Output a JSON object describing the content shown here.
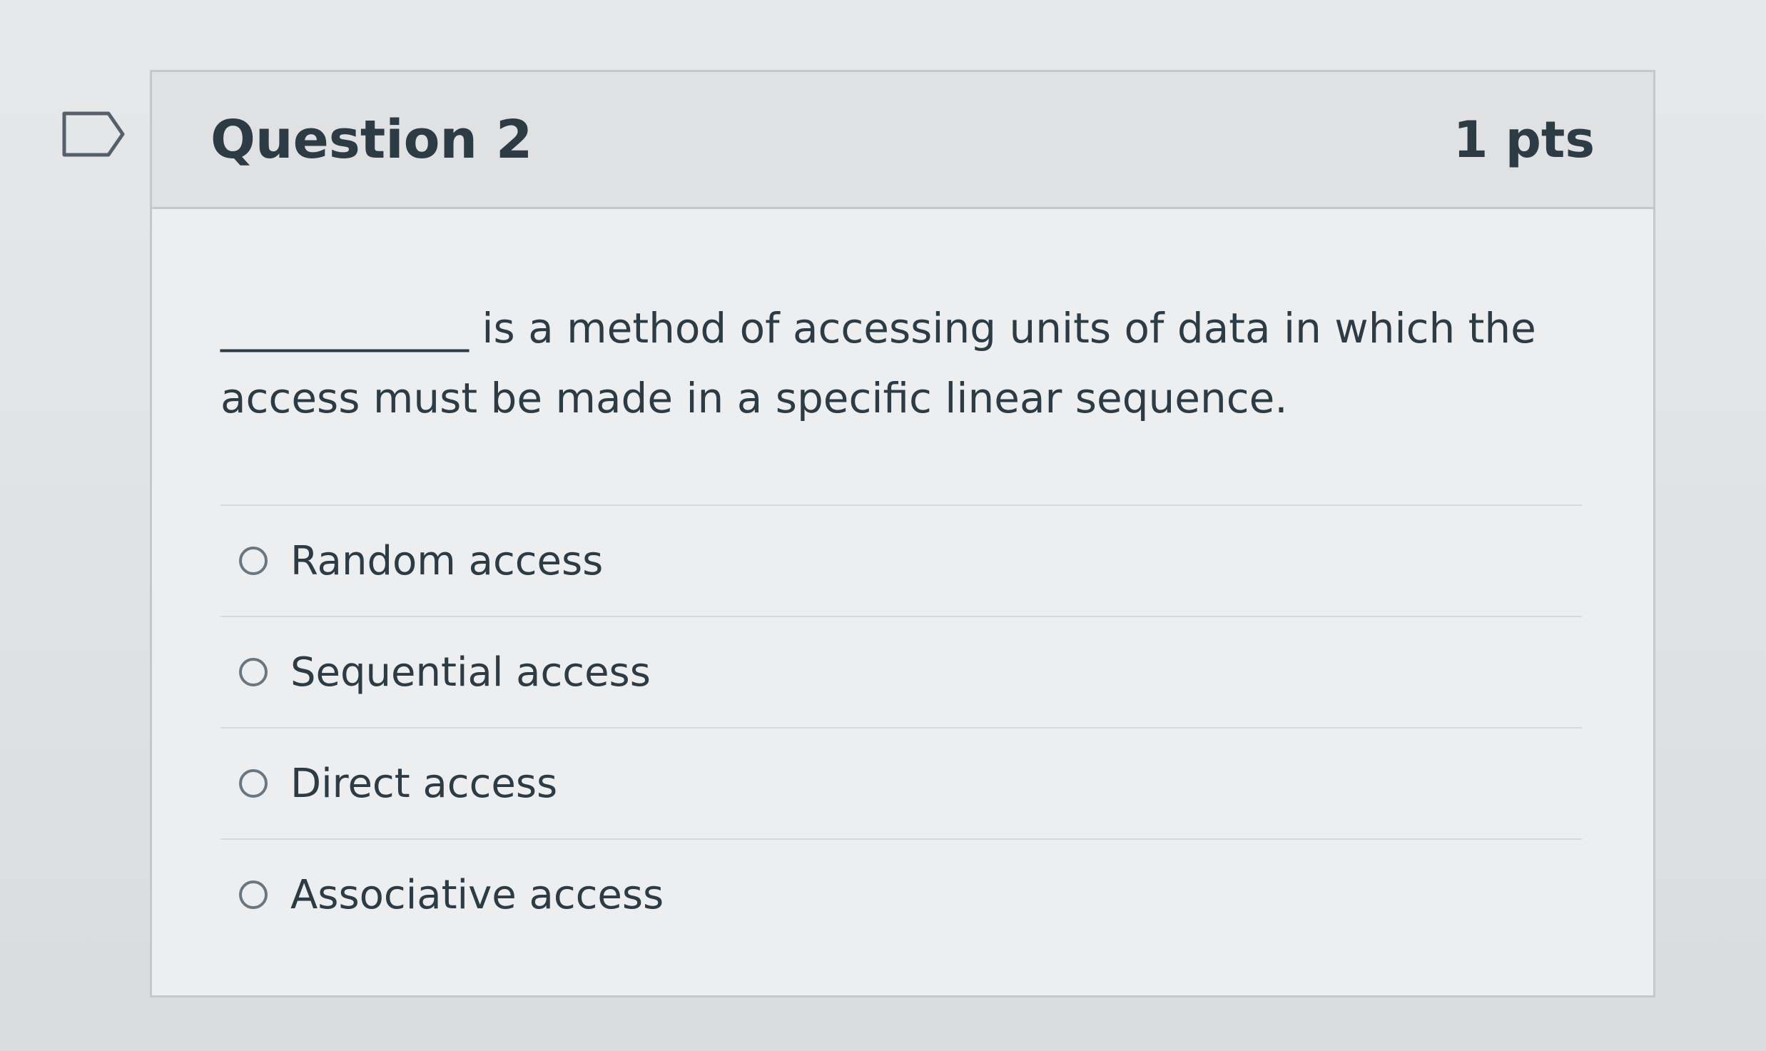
{
  "question": {
    "title": "Question 2",
    "points": "1 pts",
    "text": "____________ is a method of accessing units of data in which the access must be made in a specific linear sequence.",
    "answers": [
      {
        "label": "Random access"
      },
      {
        "label": "Sequential access"
      },
      {
        "label": "Direct access"
      },
      {
        "label": "Associative access"
      }
    ]
  },
  "icons": {
    "flag": "flag-bookmark-icon",
    "radio": "radio-button-unselected"
  },
  "colors": {
    "text": "#2d3b45",
    "header_bg": "#dfe1e3",
    "border": "#c5c8cb"
  }
}
